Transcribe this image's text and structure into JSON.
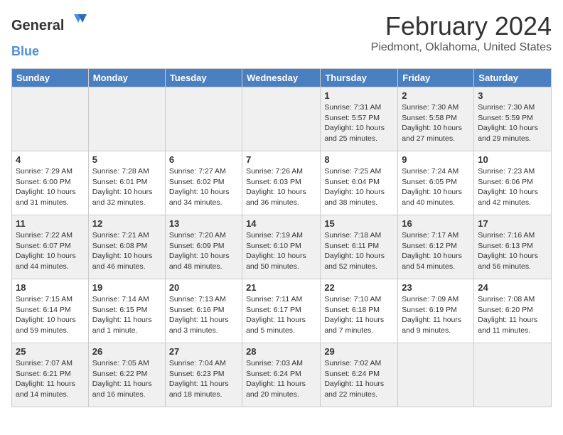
{
  "logo": {
    "general": "General",
    "blue": "Blue"
  },
  "title": "February 2024",
  "subtitle": "Piedmont, Oklahoma, United States",
  "days_header": [
    "Sunday",
    "Monday",
    "Tuesday",
    "Wednesday",
    "Thursday",
    "Friday",
    "Saturday"
  ],
  "weeks": [
    [
      {
        "day": "",
        "info": ""
      },
      {
        "day": "",
        "info": ""
      },
      {
        "day": "",
        "info": ""
      },
      {
        "day": "",
        "info": ""
      },
      {
        "day": "1",
        "info": "Sunrise: 7:31 AM\nSunset: 5:57 PM\nDaylight: 10 hours\nand 25 minutes."
      },
      {
        "day": "2",
        "info": "Sunrise: 7:30 AM\nSunset: 5:58 PM\nDaylight: 10 hours\nand 27 minutes."
      },
      {
        "day": "3",
        "info": "Sunrise: 7:30 AM\nSunset: 5:59 PM\nDaylight: 10 hours\nand 29 minutes."
      }
    ],
    [
      {
        "day": "4",
        "info": "Sunrise: 7:29 AM\nSunset: 6:00 PM\nDaylight: 10 hours\nand 31 minutes."
      },
      {
        "day": "5",
        "info": "Sunrise: 7:28 AM\nSunset: 6:01 PM\nDaylight: 10 hours\nand 32 minutes."
      },
      {
        "day": "6",
        "info": "Sunrise: 7:27 AM\nSunset: 6:02 PM\nDaylight: 10 hours\nand 34 minutes."
      },
      {
        "day": "7",
        "info": "Sunrise: 7:26 AM\nSunset: 6:03 PM\nDaylight: 10 hours\nand 36 minutes."
      },
      {
        "day": "8",
        "info": "Sunrise: 7:25 AM\nSunset: 6:04 PM\nDaylight: 10 hours\nand 38 minutes."
      },
      {
        "day": "9",
        "info": "Sunrise: 7:24 AM\nSunset: 6:05 PM\nDaylight: 10 hours\nand 40 minutes."
      },
      {
        "day": "10",
        "info": "Sunrise: 7:23 AM\nSunset: 6:06 PM\nDaylight: 10 hours\nand 42 minutes."
      }
    ],
    [
      {
        "day": "11",
        "info": "Sunrise: 7:22 AM\nSunset: 6:07 PM\nDaylight: 10 hours\nand 44 minutes."
      },
      {
        "day": "12",
        "info": "Sunrise: 7:21 AM\nSunset: 6:08 PM\nDaylight: 10 hours\nand 46 minutes."
      },
      {
        "day": "13",
        "info": "Sunrise: 7:20 AM\nSunset: 6:09 PM\nDaylight: 10 hours\nand 48 minutes."
      },
      {
        "day": "14",
        "info": "Sunrise: 7:19 AM\nSunset: 6:10 PM\nDaylight: 10 hours\nand 50 minutes."
      },
      {
        "day": "15",
        "info": "Sunrise: 7:18 AM\nSunset: 6:11 PM\nDaylight: 10 hours\nand 52 minutes."
      },
      {
        "day": "16",
        "info": "Sunrise: 7:17 AM\nSunset: 6:12 PM\nDaylight: 10 hours\nand 54 minutes."
      },
      {
        "day": "17",
        "info": "Sunrise: 7:16 AM\nSunset: 6:13 PM\nDaylight: 10 hours\nand 56 minutes."
      }
    ],
    [
      {
        "day": "18",
        "info": "Sunrise: 7:15 AM\nSunset: 6:14 PM\nDaylight: 10 hours\nand 59 minutes."
      },
      {
        "day": "19",
        "info": "Sunrise: 7:14 AM\nSunset: 6:15 PM\nDaylight: 11 hours\nand 1 minute."
      },
      {
        "day": "20",
        "info": "Sunrise: 7:13 AM\nSunset: 6:16 PM\nDaylight: 11 hours\nand 3 minutes."
      },
      {
        "day": "21",
        "info": "Sunrise: 7:11 AM\nSunset: 6:17 PM\nDaylight: 11 hours\nand 5 minutes."
      },
      {
        "day": "22",
        "info": "Sunrise: 7:10 AM\nSunset: 6:18 PM\nDaylight: 11 hours\nand 7 minutes."
      },
      {
        "day": "23",
        "info": "Sunrise: 7:09 AM\nSunset: 6:19 PM\nDaylight: 11 hours\nand 9 minutes."
      },
      {
        "day": "24",
        "info": "Sunrise: 7:08 AM\nSunset: 6:20 PM\nDaylight: 11 hours\nand 11 minutes."
      }
    ],
    [
      {
        "day": "25",
        "info": "Sunrise: 7:07 AM\nSunset: 6:21 PM\nDaylight: 11 hours\nand 14 minutes."
      },
      {
        "day": "26",
        "info": "Sunrise: 7:05 AM\nSunset: 6:22 PM\nDaylight: 11 hours\nand 16 minutes."
      },
      {
        "day": "27",
        "info": "Sunrise: 7:04 AM\nSunset: 6:23 PM\nDaylight: 11 hours\nand 18 minutes."
      },
      {
        "day": "28",
        "info": "Sunrise: 7:03 AM\nSunset: 6:24 PM\nDaylight: 11 hours\nand 20 minutes."
      },
      {
        "day": "29",
        "info": "Sunrise: 7:02 AM\nSunset: 6:24 PM\nDaylight: 11 hours\nand 22 minutes."
      },
      {
        "day": "",
        "info": ""
      },
      {
        "day": "",
        "info": ""
      }
    ]
  ],
  "row_shading": [
    true,
    false,
    true,
    false,
    true
  ]
}
